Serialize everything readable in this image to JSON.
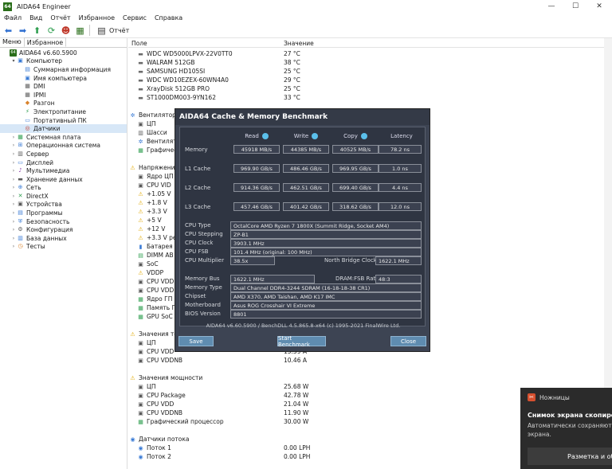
{
  "window": {
    "title": "AIDA64 Engineer",
    "minimize": "—",
    "maximize": "☐",
    "close": "✕"
  },
  "menu": [
    "Файл",
    "Вид",
    "Отчёт",
    "Избранное",
    "Сервис",
    "Справка"
  ],
  "toolbar": {
    "report_label": "Отчёт"
  },
  "left_tabs": [
    "Меню",
    "Избранное"
  ],
  "tree": [
    {
      "label": "AIDA64 v6.60.5900",
      "level": 0,
      "arrow": "",
      "icon": "aida-icon",
      "color": "#2a6e1a",
      "glyph": "64"
    },
    {
      "label": "Компьютер",
      "level": 1,
      "arrow": "▾",
      "icon": "computer-icon",
      "color": "#3a7bd5",
      "glyph": "▣"
    },
    {
      "label": "Суммарная информация",
      "level": 2,
      "arrow": "",
      "icon": "summary-icon",
      "color": "#3a7bd5",
      "glyph": "▤"
    },
    {
      "label": "Имя компьютера",
      "level": 2,
      "arrow": "",
      "icon": "computer-name-icon",
      "color": "#3a7bd5",
      "glyph": "▣"
    },
    {
      "label": "DMI",
      "level": 2,
      "arrow": "",
      "icon": "dmi-icon",
      "color": "#5a5a5a",
      "glyph": "▦"
    },
    {
      "label": "IPMI",
      "level": 2,
      "arrow": "",
      "icon": "ipmi-icon",
      "color": "#5a5a5a",
      "glyph": "▦"
    },
    {
      "label": "Разгон",
      "level": 2,
      "arrow": "",
      "icon": "overclock-icon",
      "color": "#d9822b",
      "glyph": "◆"
    },
    {
      "label": "Электропитание",
      "level": 2,
      "arrow": "",
      "icon": "power-icon",
      "color": "#2e9e4f",
      "glyph": "⚡"
    },
    {
      "label": "Портативный ПК",
      "level": 2,
      "arrow": "",
      "icon": "laptop-icon",
      "color": "#3a7bd5",
      "glyph": "▭"
    },
    {
      "label": "Датчики",
      "level": 2,
      "arrow": "",
      "icon": "sensors-icon",
      "color": "#c0392b",
      "glyph": "◎",
      "selected": true
    },
    {
      "label": "Системная плата",
      "level": 1,
      "arrow": "›",
      "icon": "motherboard-icon",
      "color": "#2e9e4f",
      "glyph": "▦"
    },
    {
      "label": "Операционная система",
      "level": 1,
      "arrow": "›",
      "icon": "os-icon",
      "color": "#3a7bd5",
      "glyph": "⊞"
    },
    {
      "label": "Сервер",
      "level": 1,
      "arrow": "›",
      "icon": "server-icon",
      "color": "#5a5a5a",
      "glyph": "▥"
    },
    {
      "label": "Дисплей",
      "level": 1,
      "arrow": "›",
      "icon": "display-icon",
      "color": "#3a7bd5",
      "glyph": "▭"
    },
    {
      "label": "Мультимедиа",
      "level": 1,
      "arrow": "›",
      "icon": "multimedia-icon",
      "color": "#8e44ad",
      "glyph": "♪"
    },
    {
      "label": "Хранение данных",
      "level": 1,
      "arrow": "›",
      "icon": "storage-icon",
      "color": "#5a5a5a",
      "glyph": "▬"
    },
    {
      "label": "Сеть",
      "level": 1,
      "arrow": "›",
      "icon": "network-icon",
      "color": "#3a7bd5",
      "glyph": "⊕"
    },
    {
      "label": "DirectX",
      "level": 1,
      "arrow": "›",
      "icon": "directx-icon",
      "color": "#2e9e4f",
      "glyph": "✕"
    },
    {
      "label": "Устройства",
      "level": 1,
      "arrow": "›",
      "icon": "devices-icon",
      "color": "#5a5a5a",
      "glyph": "▣"
    },
    {
      "label": "Программы",
      "level": 1,
      "arrow": "›",
      "icon": "programs-icon",
      "color": "#3a7bd5",
      "glyph": "▤"
    },
    {
      "label": "Безопасность",
      "level": 1,
      "arrow": "›",
      "icon": "security-icon",
      "color": "#3a7bd5",
      "glyph": "⛨"
    },
    {
      "label": "Конфигурация",
      "level": 1,
      "arrow": "›",
      "icon": "config-icon",
      "color": "#5a5a5a",
      "glyph": "⚙"
    },
    {
      "label": "База данных",
      "level": 1,
      "arrow": "›",
      "icon": "database-icon",
      "color": "#3a7bd5",
      "glyph": "▥"
    },
    {
      "label": "Тесты",
      "level": 1,
      "arrow": "›",
      "icon": "tests-icon",
      "color": "#d9822b",
      "glyph": "◷"
    }
  ],
  "columns": {
    "field": "Поле",
    "value": "Значение"
  },
  "sensor_rows": [
    {
      "label": "WDC WD5000LPVX-22V0TT0",
      "value": "27 °C",
      "kind": "item",
      "icon": "hdd-icon"
    },
    {
      "label": "WALRAM 512GB",
      "value": "38 °C",
      "kind": "item",
      "icon": "hdd-icon"
    },
    {
      "label": "SAMSUNG HD105SI",
      "value": "25 °C",
      "kind": "item",
      "icon": "hdd-icon"
    },
    {
      "label": "WDC WD10EZEX-60WN4A0",
      "value": "29 °C",
      "kind": "item",
      "icon": "hdd-icon"
    },
    {
      "label": "XrayDisk 512GB PRO",
      "value": "25 °C",
      "kind": "item",
      "icon": "hdd-icon"
    },
    {
      "label": "ST1000DM003-9YN162",
      "value": "33 °C",
      "kind": "item",
      "icon": "hdd-icon"
    },
    {
      "label": "",
      "value": "",
      "kind": "gap"
    },
    {
      "label": "Вентиляторы",
      "value": "",
      "kind": "section",
      "icon": "fan-icon"
    },
    {
      "label": "ЦП",
      "value": "",
      "kind": "item",
      "icon": "cpu-icon"
    },
    {
      "label": "Шасси",
      "value": "",
      "kind": "item",
      "icon": "chassis-icon"
    },
    {
      "label": "Вентиляторы",
      "value": "",
      "kind": "item",
      "icon": "fan-icon"
    },
    {
      "label": "Графический процессор",
      "value": "",
      "kind": "item",
      "icon": "gpu-icon"
    },
    {
      "label": "",
      "value": "",
      "kind": "gap"
    },
    {
      "label": "Напряжения",
      "value": "",
      "kind": "section",
      "icon": "voltage-icon"
    },
    {
      "label": "Ядро ЦП",
      "value": "",
      "kind": "item",
      "icon": "cpu-icon"
    },
    {
      "label": "CPU VID",
      "value": "",
      "kind": "item",
      "icon": "cpu-icon"
    },
    {
      "label": "+1.05 V",
      "value": "",
      "kind": "item",
      "icon": "warning-icon"
    },
    {
      "label": "+1.8 V",
      "value": "",
      "kind": "item",
      "icon": "warning-icon"
    },
    {
      "label": "+3.3 V",
      "value": "",
      "kind": "item",
      "icon": "warning-icon"
    },
    {
      "label": "+5 V",
      "value": "",
      "kind": "item",
      "icon": "warning-icon"
    },
    {
      "label": "+12 V",
      "value": "",
      "kind": "item",
      "icon": "warning-icon"
    },
    {
      "label": "+3.3 V резервное",
      "value": "",
      "kind": "item",
      "icon": "warning-icon"
    },
    {
      "label": "Батарея VBAT",
      "value": "",
      "kind": "item",
      "icon": "battery-icon"
    },
    {
      "label": "DIMM AB",
      "value": "",
      "kind": "item",
      "icon": "memory-icon"
    },
    {
      "label": "SoC",
      "value": "",
      "kind": "item",
      "icon": "cpu-icon"
    },
    {
      "label": "VDDP",
      "value": "",
      "kind": "item",
      "icon": "warning-icon"
    },
    {
      "label": "CPU VDD",
      "value": "",
      "kind": "item",
      "icon": "cpu-icon"
    },
    {
      "label": "CPU VDDNB",
      "value": "",
      "kind": "item",
      "icon": "cpu-icon"
    },
    {
      "label": "Ядро ГП",
      "value": "",
      "kind": "item",
      "icon": "gpu-icon"
    },
    {
      "label": "Память ГП",
      "value": "",
      "kind": "item",
      "icon": "gpu-icon"
    },
    {
      "label": "GPU SoC",
      "value": "",
      "kind": "item",
      "icon": "gpu-icon"
    },
    {
      "label": "",
      "value": "",
      "kind": "gap"
    },
    {
      "label": "Значения тока",
      "value": "",
      "kind": "section",
      "icon": "current-icon"
    },
    {
      "label": "ЦП",
      "value": "",
      "kind": "item",
      "icon": "cpu-icon"
    },
    {
      "label": "CPU VDD",
      "value": "15.59 A",
      "kind": "item",
      "icon": "cpu-icon"
    },
    {
      "label": "CPU VDDNB",
      "value": "10.46 A",
      "kind": "item",
      "icon": "cpu-icon"
    },
    {
      "label": "",
      "value": "",
      "kind": "gap"
    },
    {
      "label": "Значения мощности",
      "value": "",
      "kind": "section",
      "icon": "power-icon"
    },
    {
      "label": "ЦП",
      "value": "25.68 W",
      "kind": "item",
      "icon": "cpu-icon"
    },
    {
      "label": "CPU Package",
      "value": "42.78 W",
      "kind": "item",
      "icon": "cpu-icon"
    },
    {
      "label": "CPU VDD",
      "value": "21.04 W",
      "kind": "item",
      "icon": "cpu-icon"
    },
    {
      "label": "CPU VDDNB",
      "value": "11.90 W",
      "kind": "item",
      "icon": "cpu-icon"
    },
    {
      "label": "Графический процессор",
      "value": "30.00 W",
      "kind": "item",
      "icon": "gpu-icon"
    },
    {
      "label": "",
      "value": "",
      "kind": "gap"
    },
    {
      "label": "Датчики потока",
      "value": "",
      "kind": "section",
      "icon": "flow-icon"
    },
    {
      "label": "Поток 1",
      "value": "0.00 LPH",
      "kind": "item",
      "icon": "flow-icon"
    },
    {
      "label": "Поток 2",
      "value": "0.00 LPH",
      "kind": "item",
      "icon": "flow-icon"
    }
  ],
  "benchmark": {
    "title": "AIDA64 Cache & Memory Benchmark",
    "headers": [
      "Read",
      "Write",
      "Copy",
      "Latency"
    ],
    "rows": [
      {
        "label": "Memory",
        "read": "45918 MB/s",
        "write": "44385 MB/s",
        "copy": "40525 MB/s",
        "latency": "78.2 ns"
      },
      {
        "label": "L1 Cache",
        "read": "969.90 GB/s",
        "write": "486.46 GB/s",
        "copy": "969.95 GB/s",
        "latency": "1.0 ns"
      },
      {
        "label": "L2 Cache",
        "read": "914.36 GB/s",
        "write": "462.51 GB/s",
        "copy": "699.40 GB/s",
        "latency": "4.4 ns"
      },
      {
        "label": "L3 Cache",
        "read": "457.46 GB/s",
        "write": "401.42 GB/s",
        "copy": "318.62 GB/s",
        "latency": "12.0 ns"
      }
    ],
    "cpu_type_label": "CPU Type",
    "cpu_type": "OctalCore AMD Ryzen 7 1800X  (Summit Ridge, Socket AM4)",
    "cpu_stepping_label": "CPU Stepping",
    "cpu_stepping": "ZP-B1",
    "cpu_clock_label": "CPU Clock",
    "cpu_clock": "3903.1 MHz",
    "cpu_fsb_label": "CPU FSB",
    "cpu_fsb": "101.4 MHz  (original: 100 MHz)",
    "cpu_multiplier_label": "CPU Multiplier",
    "cpu_multiplier": "38.5x",
    "nb_clock_label": "North Bridge Clock",
    "nb_clock": "1622.1 MHz",
    "memory_bus_label": "Memory Bus",
    "memory_bus": "1622.1 MHz",
    "dram_ratio_label": "DRAM:FSB Ratio",
    "dram_ratio": "48:3",
    "memory_type_label": "Memory Type",
    "memory_type": "Dual Channel DDR4-3244 SDRAM  (16-18-18-38 CR1)",
    "chipset_label": "Chipset",
    "chipset": "AMD X370, AMD Taishan, AMD K17 IMC",
    "motherboard_label": "Motherboard",
    "motherboard": "Asus ROG Crosshair VI Extreme",
    "bios_label": "BIOS Version",
    "bios": "8801",
    "footer": "AIDA64 v6.60.5900 / BenchDLL 4.5.865.8-x64  (c) 1995-2021 FinalWire Ltd.",
    "save_label": "Save",
    "start_label": "Start Benchmark",
    "close_label": "Close"
  },
  "toast": {
    "app": "Ножницы",
    "title": "Снимок экрана скопирован",
    "text": "Автоматически сохраняются на экрана.",
    "button": "Разметка и об"
  }
}
